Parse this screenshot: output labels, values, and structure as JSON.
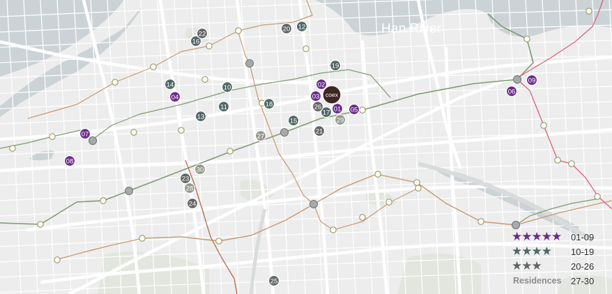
{
  "map": {
    "river_label": "Han River",
    "venue_badge": "coex"
  },
  "colors": {
    "background": "#ededed",
    "river": "#ccd3d6",
    "road": "#ffffff",
    "tier5": "#6b2a8a",
    "tier4": "#4f6766",
    "tier3": "#616566",
    "residence": "#949a8c",
    "venue": "#3e2722",
    "line_green": "#7d9b70",
    "line_orange": "#c79a72",
    "line_red": "#d6617a",
    "station_fill": "#fefde8",
    "transfer_fill": "#a8aaaa"
  },
  "hotels": [
    {
      "label": "01",
      "tier": "tier5"
    },
    {
      "label": "02",
      "tier": "tier5"
    },
    {
      "label": "03",
      "tier": "tier5"
    },
    {
      "label": "04",
      "tier": "tier5"
    },
    {
      "label": "05",
      "tier": "tier5"
    },
    {
      "label": "06",
      "tier": "tier5"
    },
    {
      "label": "07",
      "tier": "tier5"
    },
    {
      "label": "08",
      "tier": "tier5"
    },
    {
      "label": "09",
      "tier": "tier5"
    },
    {
      "label": "10",
      "tier": "tier4"
    },
    {
      "label": "11",
      "tier": "tier4"
    },
    {
      "label": "12",
      "tier": "tier4"
    },
    {
      "label": "13",
      "tier": "tier4"
    },
    {
      "label": "14",
      "tier": "tier4"
    },
    {
      "label": "15",
      "tier": "tier4"
    },
    {
      "label": "16",
      "tier": "tier4"
    },
    {
      "label": "17",
      "tier": "tier4"
    },
    {
      "label": "18",
      "tier": "tier4"
    },
    {
      "label": "19",
      "tier": "tier4"
    },
    {
      "label": "20",
      "tier": "tier3"
    },
    {
      "label": "21",
      "tier": "tier3"
    },
    {
      "label": "22",
      "tier": "tier3"
    },
    {
      "label": "23",
      "tier": "tier3"
    },
    {
      "label": "24",
      "tier": "tier3"
    },
    {
      "label": "25",
      "tier": "tier3"
    },
    {
      "label": "26",
      "tier": "tier3"
    },
    {
      "label": "27",
      "tier": "residence"
    },
    {
      "label": "28",
      "tier": "residence"
    },
    {
      "label": "29",
      "tier": "residence"
    },
    {
      "label": "30",
      "tier": "residence"
    }
  ],
  "legend": [
    {
      "stars": "★★★★★",
      "text": "",
      "range": "01-09",
      "tier": "tier5"
    },
    {
      "stars": "★★★★",
      "text": "",
      "range": "10-19",
      "tier": "tier4"
    },
    {
      "stars": "★★★",
      "text": "",
      "range": "20-26",
      "tier": "tier3"
    },
    {
      "stars": "",
      "text": "Residences",
      "range": "27-30",
      "tier": "residence"
    }
  ]
}
